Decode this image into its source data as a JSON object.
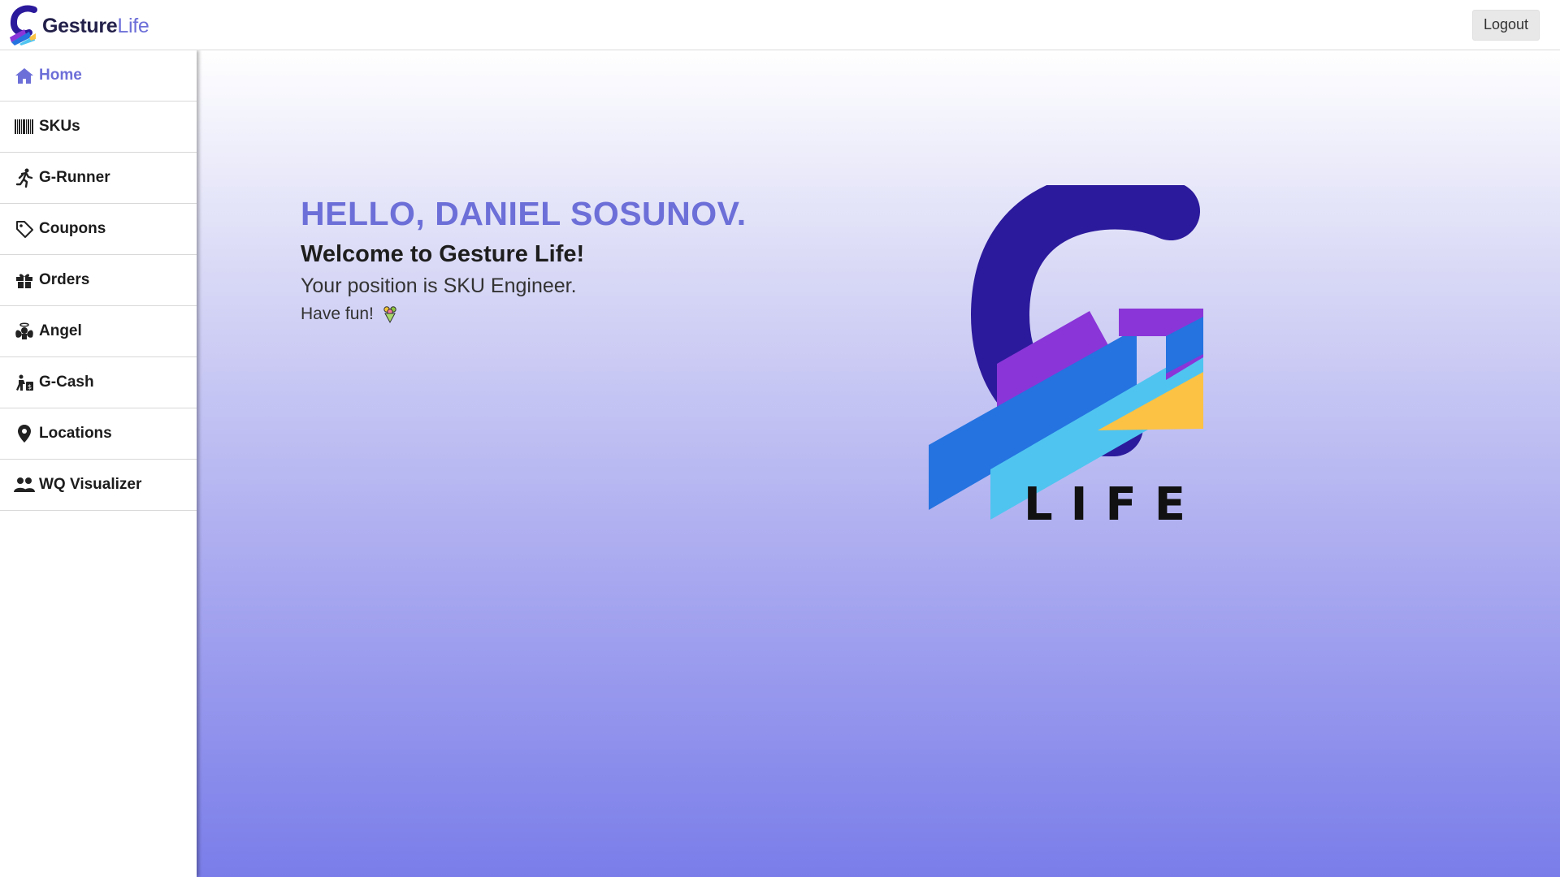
{
  "header": {
    "brand_part1": "Gesture",
    "brand_part2": "Life",
    "logout_label": "Logout"
  },
  "sidebar": {
    "items": [
      {
        "label": "Home",
        "icon": "home-icon",
        "active": true
      },
      {
        "label": "SKUs",
        "icon": "barcode-icon"
      },
      {
        "label": "G-Runner",
        "icon": "runner-icon"
      },
      {
        "label": "Coupons",
        "icon": "tag-icon"
      },
      {
        "label": "Orders",
        "icon": "gift-icon"
      },
      {
        "label": "Angel",
        "icon": "angel-icon"
      },
      {
        "label": "G-Cash",
        "icon": "cash-icon"
      },
      {
        "label": "Locations",
        "icon": "map-pin-icon"
      },
      {
        "label": "WQ Visualizer",
        "icon": "users-icon"
      }
    ]
  },
  "main": {
    "hello": "HELLO, DANIEL SOSUNOV.",
    "welcome": "Welcome to Gesture Life!",
    "position": "Your position is SKU Engineer.",
    "fun": "Have fun!",
    "logo_text": "LIFE"
  },
  "colors": {
    "accent": "#6d6fd8",
    "logo_indigo": "#2c1a9c",
    "logo_purple": "#8a35d8",
    "logo_blue": "#2473e0",
    "logo_cyan": "#4fc4f0",
    "logo_yellow": "#fcc244"
  }
}
